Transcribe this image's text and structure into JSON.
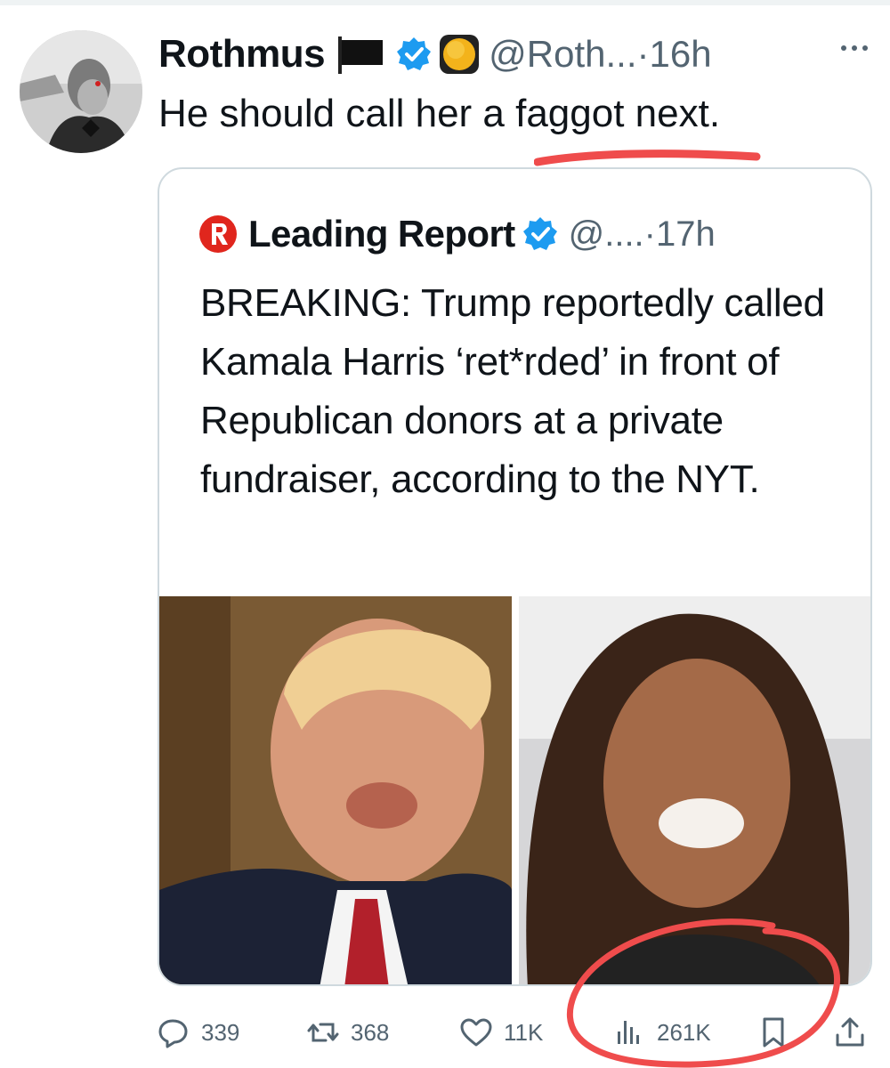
{
  "tweet": {
    "display_name": "Rothmus",
    "handle": "@Roth...",
    "time": "·16h",
    "text": "He should call her a faggot next.",
    "icons": [
      "black-flag-icon",
      "verified-badge-icon",
      "yellow-circle-emoji-icon",
      "more-options-icon"
    ]
  },
  "quoted_tweet": {
    "display_name": "Leading Report",
    "handle": "@....",
    "time": "·17h",
    "text": "BREAKING: Trump reportedly called Kamala Harris ‘ret*rded’ in front of Republican donors at a private fundraiser, according to the NYT.",
    "logo": "leading-report-logo-icon"
  },
  "actions": {
    "replies": "339",
    "reposts": "368",
    "likes": "11K",
    "views": "261K"
  },
  "colors": {
    "text": "#0f1419",
    "secondary": "#536471",
    "verified": "#1d9bf0",
    "border": "#cfd9de",
    "annotation_red": "#ef4c4c",
    "logo_red": "#e0261d"
  }
}
